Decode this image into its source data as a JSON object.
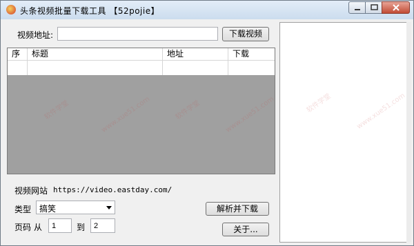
{
  "window": {
    "title": "头条视频批量下载工具  【52pojie】"
  },
  "url_row": {
    "label": "视频地址:",
    "value": "",
    "download_button": "下载视频"
  },
  "table": {
    "columns": [
      "序",
      "标题",
      "地址",
      "下载"
    ],
    "rows": []
  },
  "site": {
    "label": "视频网站",
    "url": "https://video.eastday.com/"
  },
  "type_row": {
    "label": "类型",
    "selected": "搞笑"
  },
  "page_row": {
    "label": "页码",
    "from_label": "从",
    "from_value": "1",
    "to_label": "到",
    "to_value": "2"
  },
  "buttons": {
    "parse_download": "解析并下载",
    "about": "关于..."
  },
  "watermarks": [
    "软件学堂",
    "www.xue51.com"
  ],
  "colors": {
    "window_bg": "#f0f0f0",
    "list_bg": "#a0a0a0",
    "close_button": "#c14b35"
  }
}
